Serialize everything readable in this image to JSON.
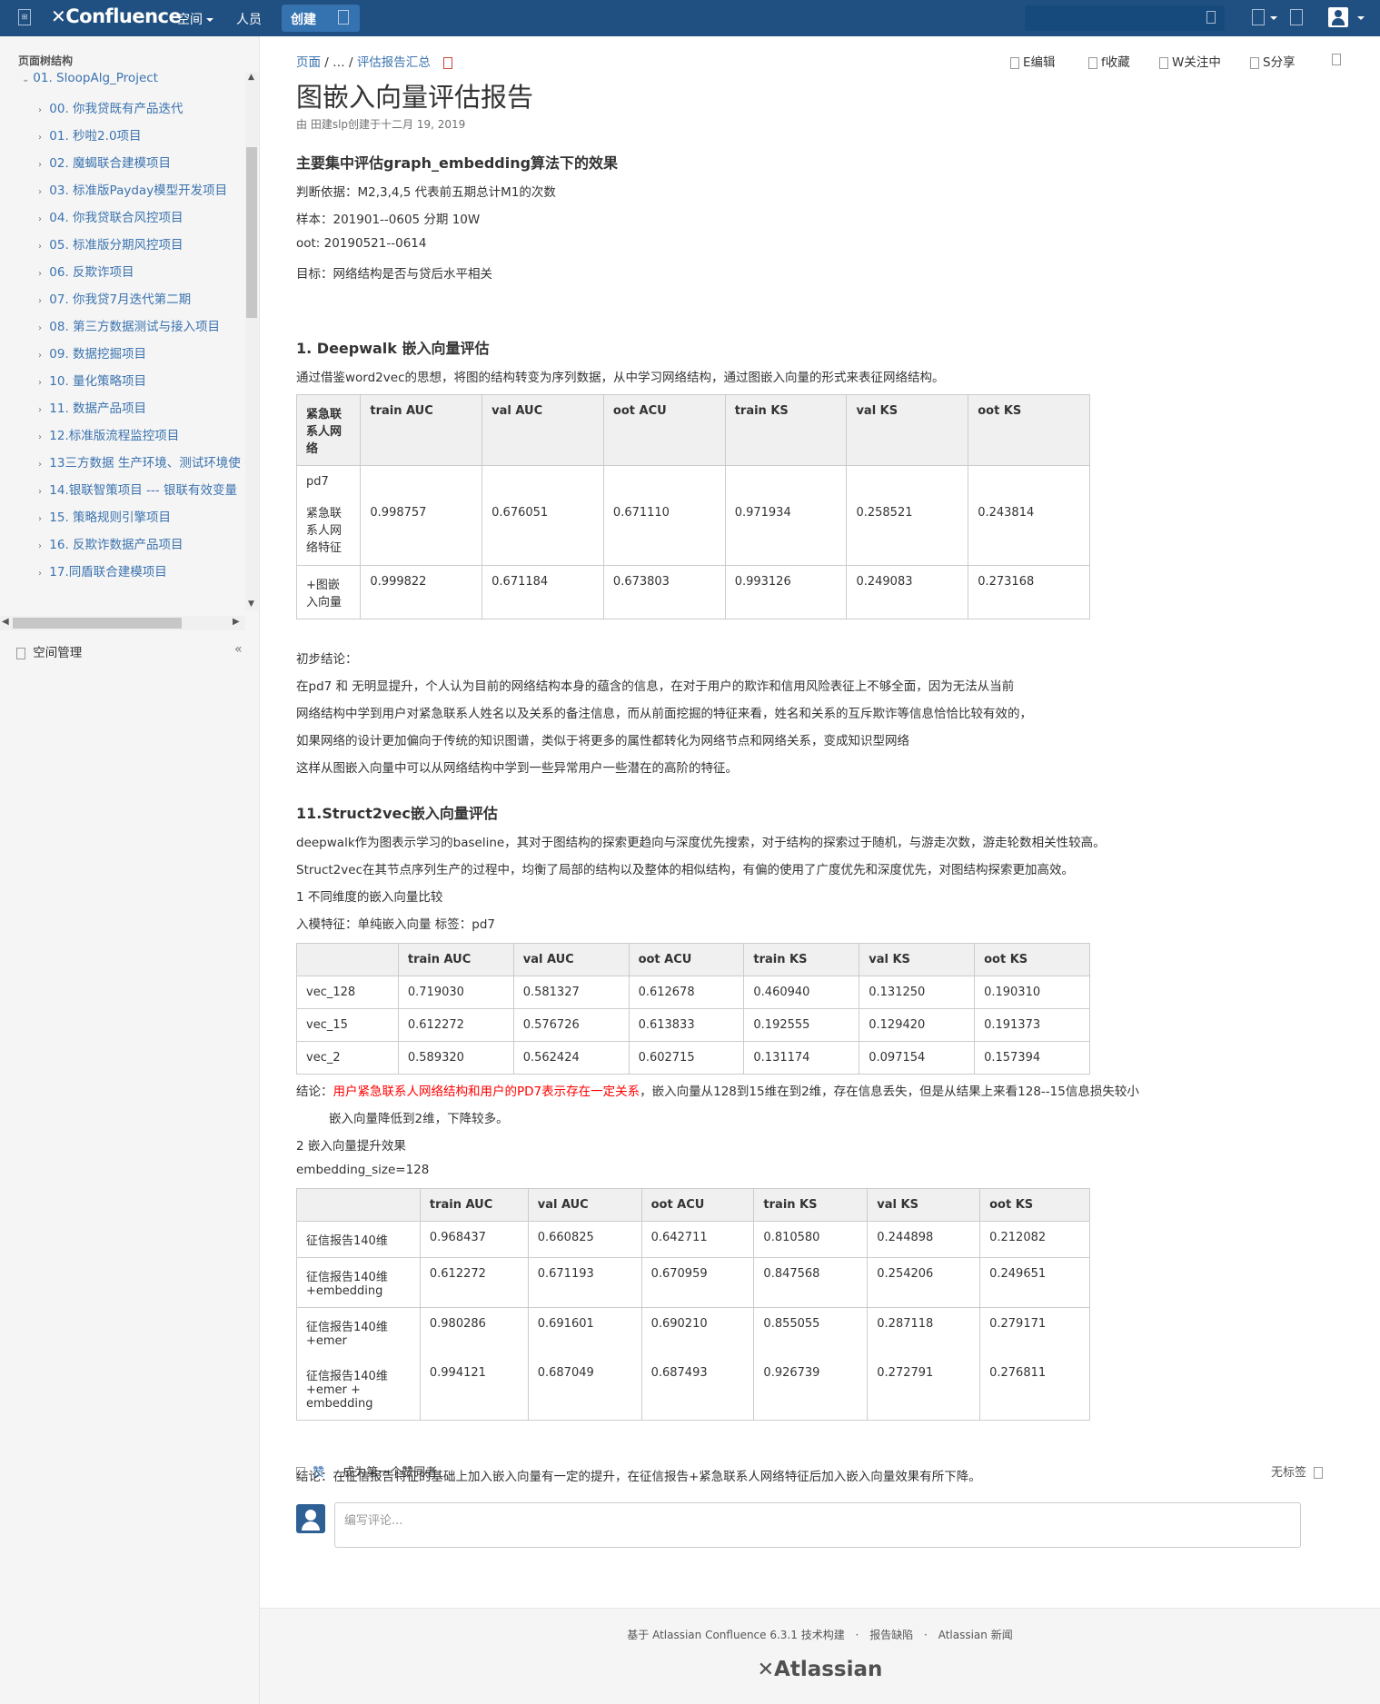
{
  "header": {
    "logo": "Confluence",
    "nav": [
      "空间",
      "人员"
    ],
    "create_label": "创建"
  },
  "sidebar": {
    "tree_title": "页面树结构",
    "root": "01. SloopAlg_Project",
    "items": [
      "00. 你我贷既有产品迭代",
      "01. 秒啦2.0项目",
      "02. 魔蝎联合建模项目",
      "03. 标准版Payday模型开发项目",
      "04. 你我贷联合风控项目",
      "05. 标准版分期风控项目",
      "06. 反欺诈项目",
      "07. 你我贷7月迭代第二期",
      "08. 第三方数据测试与接入项目",
      "09. 数据挖掘项目",
      "10. 量化策略项目",
      "11. 数据产品项目",
      "12.标准版流程监控项目",
      "13三方数据 生产环境、测试环境使",
      "14.银联智策项目 --- 银联有效变量",
      "15. 策略规则引擎项目",
      "16. 反欺诈数据产品项目",
      "17.同盾联合建模项目"
    ],
    "space_mgmt": "空间管理"
  },
  "page": {
    "breadcrumb": [
      "页面",
      "/",
      "…",
      "/",
      "评估报告汇总"
    ],
    "actions": [
      "E编辑",
      "f收藏",
      "W关注中",
      "S分享"
    ],
    "title": "图嵌入向量评估报告",
    "byline": "由 田建slp创建于十二月 19, 2019",
    "section_main": "主要集中评估graph_embedding算法下的效果",
    "intro": [
      "判断依据：M2,3,4,5 代表前五期总计M1的次数",
      "样本：201901--0605 分期  10W",
      "oot: 20190521--0614",
      "目标：网络结构是否与贷后水平相关"
    ],
    "s1_title": "1. Deepwalk 嵌入向量评估",
    "s1_desc": "通过借鉴word2vec的思想，将图的结构转变为序列数据，从中学习网络结构，通过图嵌入向量的形式来表征网络结构。",
    "table1": {
      "headers": [
        "紧急联系人网络",
        "train AUC",
        "val AUC",
        "oot ACU",
        "train KS",
        "val KS",
        "oot KS"
      ],
      "label_pd7": "pd7",
      "rows": [
        [
          "紧急联系人网络特征",
          "0.998757",
          "0.676051",
          "0.671110",
          "0.971934",
          "0.258521",
          "0.243814"
        ],
        [
          "+图嵌入向量",
          "0.999822",
          "0.671184",
          "0.673803",
          "0.993126",
          "0.249083",
          "0.273168"
        ]
      ]
    },
    "conclusion1": [
      "初步结论：",
      "在pd7 和 无明显提升，个人认为目前的网络结构本身的蕴含的信息，在对于用户的欺诈和信用风险表征上不够全面，因为无法从当前",
      "网络结构中学到用户对紧急联系人姓名以及关系的备注信息，而从前面挖掘的特征来看，姓名和关系的互斥欺诈等信息恰恰比较有效的，",
      "如果网络的设计更加偏向于传统的知识图谱，类似于将更多的属性都转化为网络节点和网络关系，变成知识型网络",
      "这样从图嵌入向量中可以从网络结构中学到一些异常用户一些潜在的高阶的特征。"
    ],
    "s2_title": "11.Struct2vec嵌入向量评估",
    "s2_desc": [
      "deepwalk作为图表示学习的baseline，其对于图结构的探索更趋向与深度优先搜索，对于结构的探索过于随机，与游走次数，游走轮数相关性较高。",
      "Struct2vec在其节点序列生产的过程中，均衡了局部的结构以及整体的相似结构，有偏的使用了广度优先和深度优先，对图结构探索更加高效。",
      "1 不同维度的嵌入向量比较",
      "入模特征：单纯嵌入向量   标签：pd7"
    ],
    "table2": {
      "headers": [
        "",
        "train AUC",
        "val AUC",
        "oot ACU",
        "train KS",
        "val KS",
        "oot KS"
      ],
      "rows": [
        [
          "vec_128",
          "0.719030",
          "0.581327",
          "0.612678",
          "0.460940",
          "0.131250",
          "0.190310"
        ],
        [
          "vec_15",
          "0.612272",
          "0.576726",
          "0.613833",
          "0.192555",
          "0.129420",
          "0.191373"
        ],
        [
          "vec_2",
          "0.589320",
          "0.562424",
          "0.602715",
          "0.131174",
          "0.097154",
          "0.157394"
        ]
      ]
    },
    "conclusion2_prefix": "结论：",
    "conclusion2_red": "用户紧急联系人网络结构和用户的PD7表示存在一定关系",
    "conclusion2_rest": "，嵌入向量从128到15维在到2维，存在信息丢失，但是从结果上来看128--15信息损失较小",
    "conclusion2_line2": "嵌入向量降低到2维，下降较多。",
    "s3_title": "2 嵌入向量提升效果",
    "s3_param": "embedding_size=128",
    "table3": {
      "headers": [
        "",
        "train AUC",
        "val AUC",
        "oot ACU",
        "train KS",
        "val KS",
        "oot KS"
      ],
      "rows": [
        [
          "征信报告140维",
          "0.968437",
          "0.660825",
          "0.642711",
          "0.810580",
          "0.244898",
          "0.212082"
        ],
        [
          "征信报告140维+embedding",
          "0.612272",
          "0.671193",
          "0.670959",
          "0.847568",
          "0.254206",
          "0.249651"
        ],
        [
          "征信报告140维+emer",
          "0.980286",
          "0.691601",
          "0.690210",
          "0.855055",
          "0.287118",
          "0.279171"
        ],
        [
          "征信报告140维+emer + embedding",
          "0.994121",
          "0.687049",
          "0.687493",
          "0.926739",
          "0.272791",
          "0.276811"
        ]
      ]
    },
    "conclusion3": "结论：在征信报告特征的基础上加入嵌入向量有一定的提升，在征信报告+紧急联系人网络特征后加入嵌入向量效果有所下降。",
    "like_label": "赞",
    "like_text": "成为第一个赞同者",
    "labels_text": "无标签",
    "comment_placeholder": "编写评论..."
  },
  "footer": {
    "links": [
      "基于 Atlassian Confluence 6.3.1 技术构建",
      "·",
      "报告缺陷",
      "·",
      "Atlassian 新闻"
    ],
    "brand": "Atlassian"
  },
  "colors": {
    "header_bg": "#205081",
    "link": "#3b73af",
    "highlight_red": "#ff0000"
  }
}
